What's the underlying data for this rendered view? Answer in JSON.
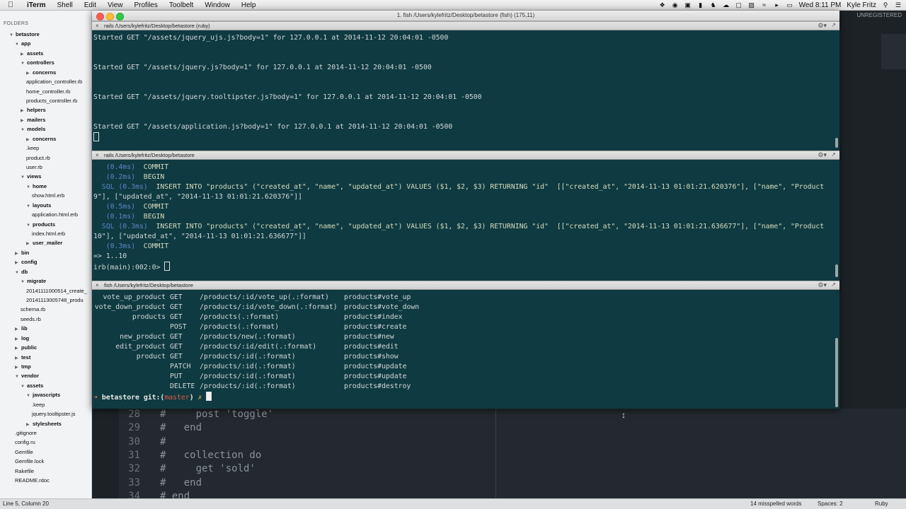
{
  "menubar": {
    "apple": "",
    "app": "iTerm",
    "menus": [
      "Shell",
      "Edit",
      "View",
      "Profiles",
      "Toolbelt",
      "Window",
      "Help"
    ],
    "clock": "Wed 8:11 PM",
    "user": "Kyle Fritz"
  },
  "iterm": {
    "window_title": "1. fish  /Users/kylefritz/Desktop/betastore (fish) (175,11)",
    "panes": [
      {
        "title": "rails  /Users/kylefritz/Desktop/betastore (ruby)",
        "lines": [
          "Started GET \"/assets/jquery_ujs.js?body=1\" for 127.0.0.1 at 2014-11-12 20:04:01 -0500",
          "",
          "",
          "Started GET \"/assets/jquery.js?body=1\" for 127.0.0.1 at 2014-11-12 20:04:01 -0500",
          "",
          "",
          "Started GET \"/assets/jquery.tooltipster.js?body=1\" for 127.0.0.1 at 2014-11-12 20:04:01 -0500",
          "",
          "",
          "Started GET \"/assets/application.js?body=1\" for 127.0.0.1 at 2014-11-12 20:04:01 -0500"
        ]
      },
      {
        "title": "rails  /Users/kylefritz/Desktop/betastore",
        "lines": [
          {
            "t": "(0.4ms)",
            "k": "COMMIT",
            "indent": "   "
          },
          {
            "t": "(0.2ms)",
            "k": "BEGIN",
            "indent": "   "
          },
          {
            "t": "SQL (0.3ms)",
            "k": "INSERT INTO \"products\" (\"created_at\", \"name\", \"updated_at\") VALUES ($1, $2, $3) RETURNING \"id\"  [[\"created_at\", \"2014-11-13 01:01:21.620376\"], [\"name\", \"Product",
            "indent": "  "
          },
          {
            "plain": "9\"], [\"updated_at\", \"2014-11-13 01:01:21.620376\"]]"
          },
          {
            "t": "(0.5ms)",
            "k": "COMMIT",
            "indent": "   "
          },
          {
            "t": "(0.1ms)",
            "k": "BEGIN",
            "indent": "   "
          },
          {
            "t": "SQL (0.3ms)",
            "k": "INSERT INTO \"products\" (\"created_at\", \"name\", \"updated_at\") VALUES ($1, $2, $3) RETURNING \"id\"  [[\"created_at\", \"2014-11-13 01:01:21.636677\"], [\"name\", \"Product",
            "indent": "  "
          },
          {
            "plain": "10\"], [\"updated_at\", \"2014-11-13 01:01:21.636677\"]]"
          },
          {
            "t": "(0.3ms)",
            "k": "COMMIT",
            "indent": "   "
          },
          {
            "plain": "=> 1..10"
          },
          {
            "plain": "irb(main):002:0> "
          }
        ]
      },
      {
        "title": "fish  /Users/kylefritz/Desktop/betastore",
        "routes": [
          [
            "vote_up_product",
            "GET",
            "/products/:id/vote_up(.:format)",
            "products#vote_up"
          ],
          [
            "vote_down_product",
            "GET",
            "/products/:id/vote_down(.:format)",
            "products#vote_down"
          ],
          [
            "products",
            "GET",
            "/products(.:format)",
            "products#index"
          ],
          [
            "",
            "POST",
            "/products(.:format)",
            "products#create"
          ],
          [
            "new_product",
            "GET",
            "/products/new(.:format)",
            "products#new"
          ],
          [
            "edit_product",
            "GET",
            "/products/:id/edit(.:format)",
            "products#edit"
          ],
          [
            "product",
            "GET",
            "/products/:id(.:format)",
            "products#show"
          ],
          [
            "",
            "PATCH",
            "/products/:id(.:format)",
            "products#update"
          ],
          [
            "",
            "PUT",
            "/products/:id(.:format)",
            "products#update"
          ],
          [
            "",
            "DELETE",
            "/products/:id(.:format)",
            "products#destroy"
          ]
        ],
        "prompt": {
          "arrow": "➜",
          "dir": "betastore",
          "git": "git:(",
          "branch": "master",
          "git_end": ")",
          "mark": "✗"
        }
      }
    ]
  },
  "sidebar": {
    "header": "FOLDERS",
    "items": [
      {
        "label": "betastore",
        "depth": 0,
        "dir": true,
        "open": true
      },
      {
        "label": "app",
        "depth": 1,
        "dir": true,
        "open": true
      },
      {
        "label": "assets",
        "depth": 2,
        "dir": true,
        "open": false
      },
      {
        "label": "controllers",
        "depth": 2,
        "dir": true,
        "open": true
      },
      {
        "label": "concerns",
        "depth": 3,
        "dir": true,
        "open": false
      },
      {
        "label": "application_controller.rb",
        "depth": 3,
        "dir": false
      },
      {
        "label": "home_controller.rb",
        "depth": 3,
        "dir": false
      },
      {
        "label": "products_controller.rb",
        "depth": 3,
        "dir": false
      },
      {
        "label": "helpers",
        "depth": 2,
        "dir": true,
        "open": false
      },
      {
        "label": "mailers",
        "depth": 2,
        "dir": true,
        "open": false
      },
      {
        "label": "models",
        "depth": 2,
        "dir": true,
        "open": true
      },
      {
        "label": "concerns",
        "depth": 3,
        "dir": true,
        "open": false
      },
      {
        "label": ".keep",
        "depth": 3,
        "dir": false
      },
      {
        "label": "product.rb",
        "depth": 3,
        "dir": false
      },
      {
        "label": "user.rb",
        "depth": 3,
        "dir": false
      },
      {
        "label": "views",
        "depth": 2,
        "dir": true,
        "open": true
      },
      {
        "label": "home",
        "depth": 3,
        "dir": true,
        "open": true
      },
      {
        "label": "show.html.erb",
        "depth": 4,
        "dir": false
      },
      {
        "label": "layouts",
        "depth": 3,
        "dir": true,
        "open": true
      },
      {
        "label": "application.html.erb",
        "depth": 4,
        "dir": false
      },
      {
        "label": "products",
        "depth": 3,
        "dir": true,
        "open": true
      },
      {
        "label": "index.html.erb",
        "depth": 4,
        "dir": false
      },
      {
        "label": "user_mailer",
        "depth": 3,
        "dir": true,
        "open": false
      },
      {
        "label": "bin",
        "depth": 1,
        "dir": true,
        "open": false
      },
      {
        "label": "config",
        "depth": 1,
        "dir": true,
        "open": false
      },
      {
        "label": "db",
        "depth": 1,
        "dir": true,
        "open": true
      },
      {
        "label": "migrate",
        "depth": 2,
        "dir": true,
        "open": true
      },
      {
        "label": "20141111000514_create_",
        "depth": 3,
        "dir": false
      },
      {
        "label": "20141113005748_produ",
        "depth": 3,
        "dir": false
      },
      {
        "label": "schema.rb",
        "depth": 2,
        "dir": false
      },
      {
        "label": "seeds.rb",
        "depth": 2,
        "dir": false
      },
      {
        "label": "lib",
        "depth": 1,
        "dir": true,
        "open": false
      },
      {
        "label": "log",
        "depth": 1,
        "dir": true,
        "open": false
      },
      {
        "label": "public",
        "depth": 1,
        "dir": true,
        "open": false
      },
      {
        "label": "test",
        "depth": 1,
        "dir": true,
        "open": false
      },
      {
        "label": "tmp",
        "depth": 1,
        "dir": true,
        "open": false
      },
      {
        "label": "vendor",
        "depth": 1,
        "dir": true,
        "open": true
      },
      {
        "label": "assets",
        "depth": 2,
        "dir": true,
        "open": true
      },
      {
        "label": "javascripts",
        "depth": 3,
        "dir": true,
        "open": true
      },
      {
        "label": ".keep",
        "depth": 4,
        "dir": false
      },
      {
        "label": "jquery.tooltipster.js",
        "depth": 4,
        "dir": false
      },
      {
        "label": "stylesheets",
        "depth": 3,
        "dir": true,
        "open": false
      },
      {
        "label": ".gitignore",
        "depth": 1,
        "dir": false
      },
      {
        "label": "config.ru",
        "depth": 1,
        "dir": false
      },
      {
        "label": "Gemfile",
        "depth": 1,
        "dir": false
      },
      {
        "label": "Gemfile.lock",
        "depth": 1,
        "dir": false
      },
      {
        "label": "Rakefile",
        "depth": 1,
        "dir": false
      },
      {
        "label": "README.rdoc",
        "depth": 1,
        "dir": false
      }
    ]
  },
  "editor": {
    "lines": [
      {
        "num": "28",
        "code": "#     post 'toggle'"
      },
      {
        "num": "29",
        "code": "#   end"
      },
      {
        "num": "30",
        "code": "#"
      },
      {
        "num": "31",
        "code": "#   collection do"
      },
      {
        "num": "32",
        "code": "#     get 'sold'"
      },
      {
        "num": "33",
        "code": "#   end"
      },
      {
        "num": "34",
        "code": "# end"
      }
    ],
    "unregistered": "UNREGISTERED"
  },
  "statusbar": {
    "position": "Line 5, Column 20",
    "spelling": "14 misspelled words",
    "spaces": "Spaces: 2",
    "syntax": "Ruby"
  },
  "colors": {
    "terminal_bg": "#0f3a41",
    "sql_blue": "#5c87c8",
    "git_branch_red": "#e05b45",
    "prompt_arrow": "#e36b38"
  }
}
